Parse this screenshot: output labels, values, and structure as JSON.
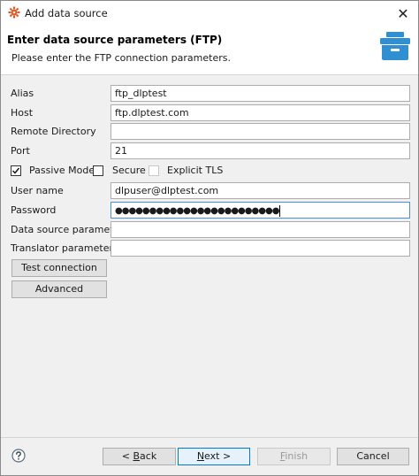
{
  "window": {
    "title": "Add data source",
    "close_label": "✕"
  },
  "header": {
    "title": "Enter data source parameters (FTP)",
    "subtitle": "Please enter the FTP connection parameters."
  },
  "form": {
    "alias": {
      "label": "Alias",
      "value": "ftp_dlptest"
    },
    "host": {
      "label": "Host",
      "value": "ftp.dlptest.com"
    },
    "remote_directory": {
      "label": "Remote Directory",
      "value": ""
    },
    "port": {
      "label": "Port",
      "value": "21"
    },
    "passive_mode": {
      "label": "Passive Mode",
      "checked": true
    },
    "secure": {
      "label": "Secure",
      "checked": false
    },
    "explicit_tls": {
      "label": "Explicit TLS",
      "checked": false,
      "enabled": false
    },
    "user_name": {
      "label": "User name",
      "value": "dlpuser@dlptest.com"
    },
    "password": {
      "label": "Password",
      "value": "●●●●●●●●●●●●●●●●●●●●●●●●"
    },
    "data_source_parameters": {
      "label": "Data source parameters",
      "value": ""
    },
    "translator_parameters": {
      "label": "Translator parameters",
      "value": ""
    }
  },
  "buttons": {
    "test_connection": "Test connection",
    "advanced": "Advanced",
    "back_prefix": "< ",
    "back_mnemonic": "B",
    "back_rest": "ack",
    "next_mnemonic": "N",
    "next_rest": "ext >",
    "finish_mnemonic": "F",
    "finish_rest": "inish",
    "cancel": "Cancel"
  },
  "icons": {
    "app": "gear-logo-icon",
    "header": "database-box-icon",
    "help": "help-icon"
  },
  "colors": {
    "accent": "#0078d7",
    "app_icon": "#e8531e",
    "header_icon": "#2f8fd0"
  }
}
